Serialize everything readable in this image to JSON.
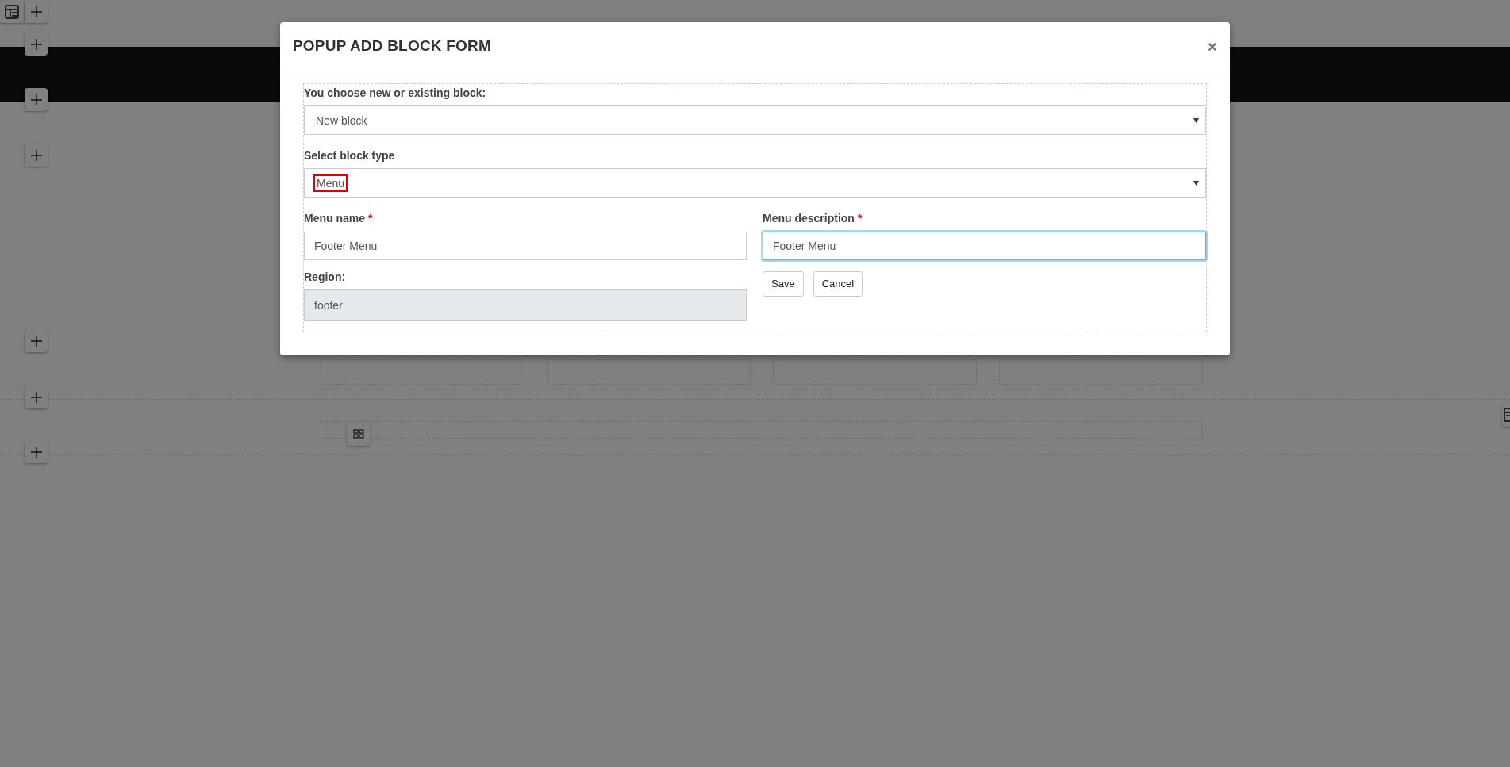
{
  "modal": {
    "title": "POPUP ADD BLOCK FORM",
    "close": "×",
    "block_source": {
      "label": "You choose new or existing block:",
      "value": "New block"
    },
    "block_type": {
      "label": "Select block type",
      "value": "Menu",
      "highlighted": true
    },
    "menu_name": {
      "label": "Menu name",
      "required_mark": "*",
      "value": "Footer Menu"
    },
    "menu_description": {
      "label": "Menu description",
      "required_mark": "*",
      "value": "Footer Menu",
      "focused": true
    },
    "region": {
      "label": "Region:",
      "value": "footer",
      "disabled": true
    },
    "buttons": [
      "Save",
      "Cancel"
    ]
  }
}
